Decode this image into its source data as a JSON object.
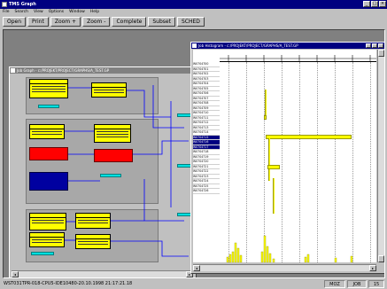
{
  "app": {
    "title": "TMS Graph",
    "menu": [
      "File",
      "Search",
      "View",
      "Options",
      "Window",
      "Help"
    ],
    "toolbar": [
      "Open",
      "Print",
      "Zoom +",
      "Zoom -",
      "Complete",
      "Subset",
      "SCHED"
    ]
  },
  "graph_window": {
    "title": "Job Graph - c:/PROJEKT/PROJECT/GRAPHS/A_TEST.GP"
  },
  "histogram_window": {
    "title": "Job Histogram - c:/PROJEKT/PROJECT/GRAPHS/A_TEST.GP",
    "row_labels": [
      "W0704700",
      "W0704701",
      "W0704702",
      "W0704703",
      "W0704704",
      "W0704705",
      "W0704706",
      "W0704707",
      "W0704708",
      "W0704709",
      "W0704710",
      "W0704711",
      "W0704712",
      "W0704713",
      "W0704714",
      "W0704715",
      "W0704716",
      "W0704717",
      "W0704718",
      "W0704719",
      "W0704720",
      "W0704721",
      "W0704722",
      "W0704723",
      "W0704724",
      "W0704725",
      "W0704726"
    ]
  },
  "statusbar": {
    "text": "WST031TPR-018-CPU5-IDE10480-20.10.1998 21:17:21.18",
    "panels": [
      "MOZ",
      "JOB",
      "15"
    ]
  },
  "colors": {
    "node_fill": "#ffff00",
    "node_error": "#ff0000",
    "node_running": "#0000a0",
    "connector": "#0000ff",
    "marker": "#00e0e0"
  }
}
